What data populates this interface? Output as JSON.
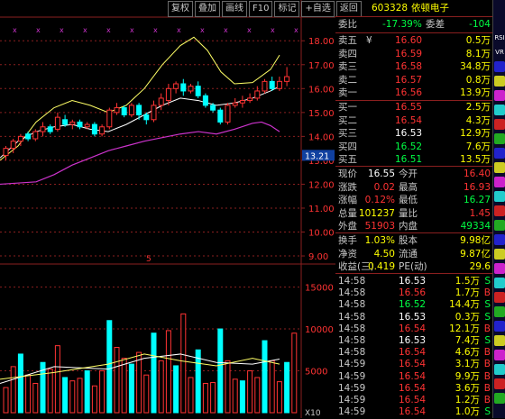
{
  "toolbar": [
    "复权",
    "叠加",
    "画线",
    "F10",
    "标记",
    "+自选",
    "返回"
  ],
  "header": {
    "code": "603328",
    "name": "依顿电子",
    "wei_bi_label": "委比",
    "wei_bi": "-17.39%",
    "wei_cha_label": "委差",
    "wei_cha": "-104"
  },
  "sell": [
    {
      "label": "卖五",
      "price": "16.60",
      "vol": "0.5万",
      "yen": "¥"
    },
    {
      "label": "卖四",
      "price": "16.59",
      "vol": "8.1万"
    },
    {
      "label": "卖三",
      "price": "16.58",
      "vol": "34.8万"
    },
    {
      "label": "卖二",
      "price": "16.57",
      "vol": "0.8万"
    },
    {
      "label": "卖一",
      "price": "16.56",
      "vol": "13.9万"
    }
  ],
  "buy": [
    {
      "label": "买一",
      "price": "16.55",
      "vol": "2.5万"
    },
    {
      "label": "买二",
      "price": "16.54",
      "vol": "4.3万"
    },
    {
      "label": "买三",
      "price": "16.53",
      "vol": "12.9万"
    },
    {
      "label": "买四",
      "price": "16.52",
      "vol": "7.6万"
    },
    {
      "label": "买五",
      "price": "16.51",
      "vol": "13.5万"
    }
  ],
  "stats1": [
    {
      "l1": "现价",
      "v1": "16.55",
      "l2": "今开",
      "v2": "16.40"
    },
    {
      "l1": "涨跌",
      "v1": "0.02",
      "l2": "最高",
      "v2": "16.93"
    },
    {
      "l1": "涨幅",
      "v1": "0.12%",
      "l2": "最低",
      "v2": "16.27"
    },
    {
      "l1": "总量",
      "v1": "101237",
      "l2": "量比",
      "v2": "1.45"
    },
    {
      "l1": "外盘",
      "v1": "51903",
      "l2": "内盘",
      "v2": "49334"
    }
  ],
  "stats2": [
    {
      "l1": "换手",
      "v1": "1.03%",
      "l2": "股本",
      "v2": "9.98亿"
    },
    {
      "l1": "净资",
      "v1": "4.50",
      "l2": "流通",
      "v2": "9.87亿"
    },
    {
      "l1": "收益(三)",
      "v1": "0.419",
      "l2": "PE(动)",
      "v2": "29.6"
    }
  ],
  "ticks": [
    {
      "time": "14:58",
      "price": "16.53",
      "vol": "1.5万",
      "bs": "S"
    },
    {
      "time": "14:58",
      "price": "16.56",
      "vol": "1.7万",
      "bs": "B"
    },
    {
      "time": "14:58",
      "price": "16.52",
      "vol": "14.4万",
      "bs": "S"
    },
    {
      "time": "14:58",
      "price": "16.53",
      "vol": "0.3万",
      "bs": "S"
    },
    {
      "time": "14:58",
      "price": "16.54",
      "vol": "12.1万",
      "bs": "B"
    },
    {
      "time": "14:58",
      "price": "16.53",
      "vol": "7.4万",
      "bs": "S"
    },
    {
      "time": "14:58",
      "price": "16.54",
      "vol": "4.6万",
      "bs": "B"
    },
    {
      "time": "14:59",
      "price": "16.54",
      "vol": "3.1万",
      "bs": "B"
    },
    {
      "time": "14:59",
      "price": "16.54",
      "vol": "9.9万",
      "bs": "B"
    },
    {
      "time": "14:59",
      "price": "16.54",
      "vol": "3.6万",
      "bs": "B"
    },
    {
      "time": "14:59",
      "price": "16.54",
      "vol": "1.2万",
      "bs": "B"
    },
    {
      "time": "14:59",
      "price": "16.54",
      "vol": "1.0万",
      "bs": "S"
    }
  ],
  "chart": {
    "price_ticks": [
      "18.00",
      "17.00",
      "16.00",
      "15.00",
      "14.00",
      "13.00",
      "12.00",
      "11.00",
      "10.00",
      "9.00"
    ],
    "current_price_tag": "13.21",
    "vol_ticks": [
      "15000",
      "10000",
      "5000"
    ],
    "vol_unit": "X10",
    "marker": "5"
  },
  "sidebar_icons": [
    "RSI",
    "VR"
  ],
  "colors": {
    "up": "#ff3333",
    "down": "#00ffff",
    "flat": "#ffffff",
    "label": "#c8c8c8",
    "volume": "#ffff00",
    "grid": "#8a1f1f",
    "ma_yellow": "#ffff66",
    "ma_white": "#ffffff",
    "ma_purple": "#cc33cc"
  }
}
